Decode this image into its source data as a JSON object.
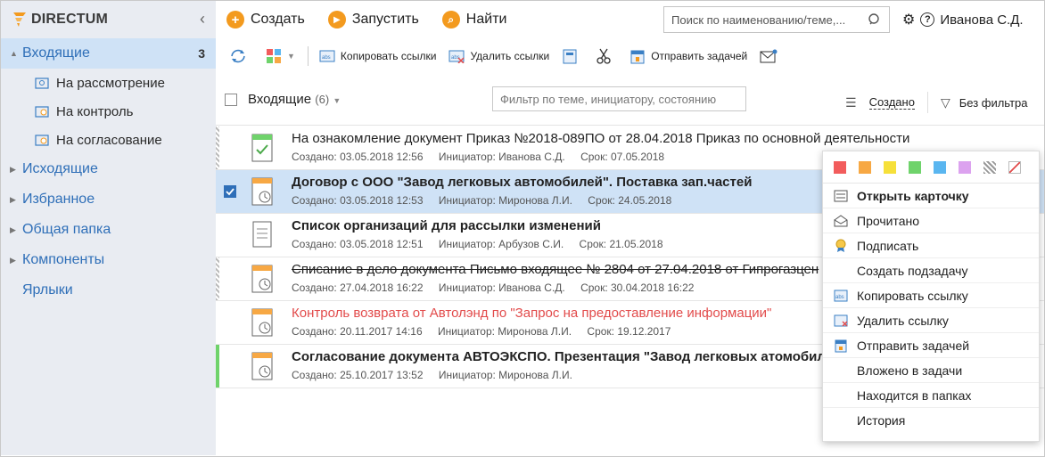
{
  "app": {
    "logo_text": "DIRECTUM"
  },
  "sidebar": {
    "items": [
      {
        "label": "Входящие",
        "count": "3"
      },
      {
        "label": "На рассмотрение"
      },
      {
        "label": "На контроль"
      },
      {
        "label": "На согласование"
      },
      {
        "label": "Исходящие"
      },
      {
        "label": "Избранное"
      },
      {
        "label": "Общая папка"
      },
      {
        "label": "Компоненты"
      },
      {
        "label": "Ярлыки"
      }
    ]
  },
  "topbar": {
    "create": "Создать",
    "launch": "Запустить",
    "find": "Найти",
    "search_placeholder": "Поиск по наименованию/теме,...",
    "user": "Иванова С.Д."
  },
  "toolbar": {
    "copy_links": "Копировать ссылки",
    "delete_links": "Удалить ссылки",
    "send_task": "Отправить задачей"
  },
  "filter": {
    "title": "Входящие",
    "count": "(6)",
    "placeholder": "Фильтр по теме, инициатору, состоянию",
    "sort_label": "Создано",
    "filter_label": "Без фильтра"
  },
  "list": [
    {
      "title": "На ознакомление документ Приказ №2018-089ПО от 28.04.2018 Приказ по основной деятельности",
      "created": "Создано: 03.05.2018 12:56",
      "initiator": "Инициатор: Иванова С.Д.",
      "deadline": "Срок: 07.05.2018"
    },
    {
      "title": "Договор с ООО \"Завод легковых автомобилей\". Поставка зап.частей",
      "created": "Создано: 03.05.2018 12:53",
      "initiator": "Инициатор: Миронова Л.И.",
      "deadline": "Срок: 24.05.2018"
    },
    {
      "title": "Список организаций для рассылки изменений",
      "created": "Создано: 03.05.2018 12:51",
      "initiator": "Инициатор: Арбузов С.И.",
      "deadline": "Срок: 21.05.2018"
    },
    {
      "title": "Списание в дело документа Письмо входящее № 2804 от 27.04.2018 от Гипрогазцен",
      "created": "Создано: 27.04.2018 16:22",
      "initiator": "Инициатор: Иванова С.Д.",
      "deadline": "Срок: 30.04.2018 16:22"
    },
    {
      "title": "Контроль возврата от Автолэнд по \"Запрос на предоставление информации\"",
      "created": "Создано: 20.11.2017 14:16",
      "initiator": "Инициатор: Миронова Л.И.",
      "deadline": "Срок: 19.12.2017"
    },
    {
      "title": "Согласование документа АВТОЭКСПО. Презентация \"Завод легковых атомобилей\"",
      "created": "Создано: 25.10.2017 13:52",
      "initiator": "Инициатор: Миронова Л.И.",
      "deadline": ""
    }
  ],
  "context_menu": {
    "colors": [
      "#f25c5c",
      "#f7a844",
      "#f6e03a",
      "#6fd36b",
      "#5ab6f0",
      "#dca2ef"
    ],
    "items": [
      "Открыть карточку",
      "Прочитано",
      "Подписать",
      "Создать подзадачу",
      "Копировать ссылку",
      "Удалить ссылку",
      "Отправить задачей",
      "Вложено в задачи",
      "Находится в папках",
      "История"
    ]
  }
}
